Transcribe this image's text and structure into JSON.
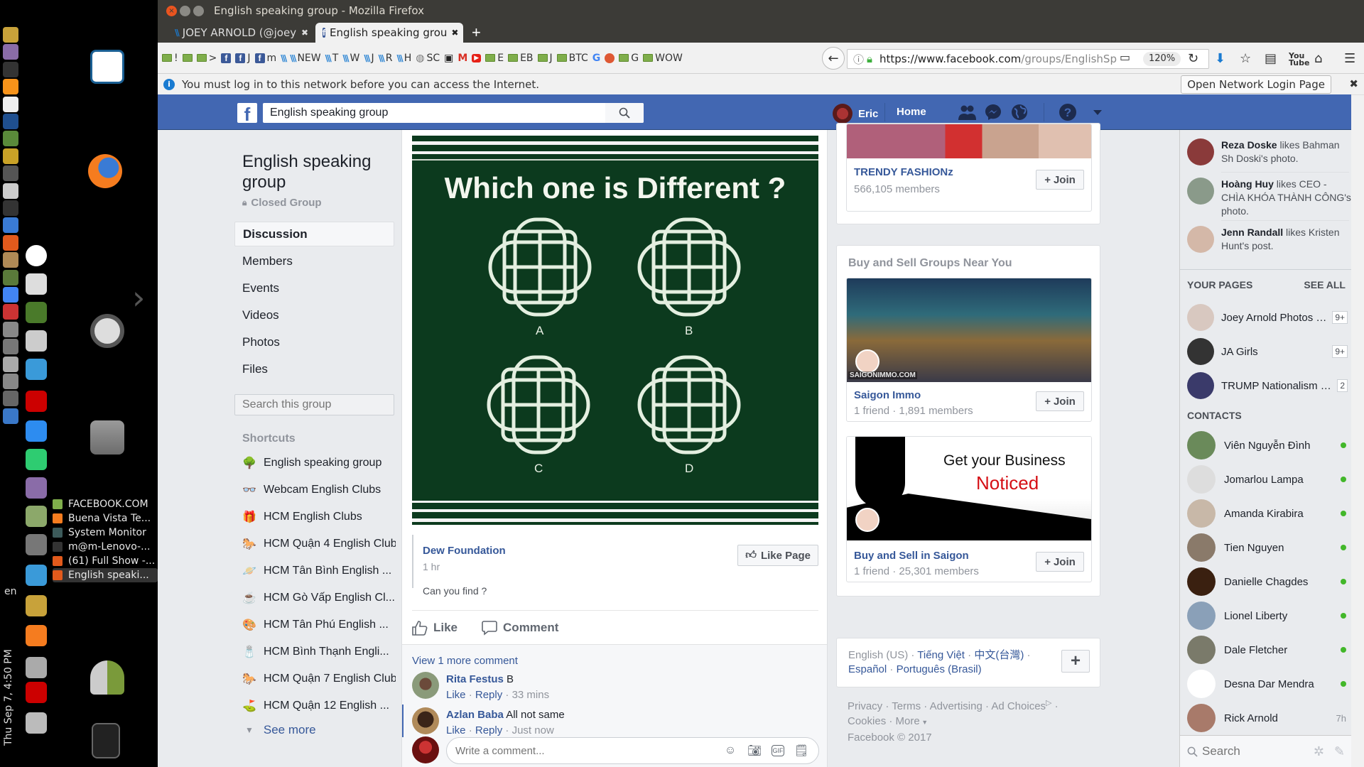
{
  "desktop": {
    "left_launcher_icons": [
      "dogecoin-icon",
      "face-icon",
      "inkscape-icon",
      "bitcoin-icon",
      "text-editor-icon",
      "calculator-icon",
      "terminal-icon",
      "workspace-icon",
      "window-switch-icon",
      "screenshot-icon",
      "system-monitor-icon",
      "media-player-icon",
      "audacity-icon",
      "archive-icon",
      "settings-icon",
      "chromium-icon",
      "joystick-icon",
      "lock-screen-icon",
      "disk-icon",
      "drive-icon",
      "drive-settings-icon",
      "update-icon",
      "back-icon"
    ],
    "second_column_icons": [
      "obs-icon",
      "volume-knob-icon",
      "network-card-icon",
      "webcam-icon",
      "electrum-icon",
      "filezilla-icon",
      "app-icon",
      "telegram-icon",
      "cheese-icon",
      "hanger-icon",
      "gpu-icon",
      "litecoin-icon",
      "dogecoin-icon",
      "vlc-icon",
      "bluetooth-icon",
      "filezilla-icon",
      "image-viewer-icon"
    ],
    "desktop_icons": [
      "libreoffice-writer-icon",
      "firefox-icon",
      "ubuntu-icon",
      "file-cabinet-icon",
      "user-switch-icon",
      "trash-icon"
    ],
    "window_list": [
      {
        "label": "FACEBOOK.COM",
        "icon": "folder-icon"
      },
      {
        "label": "Buena Vista Te...",
        "icon": "vlc-icon"
      },
      {
        "label": "System Monitor",
        "icon": "system-monitor-icon"
      },
      {
        "label": "m@m-Lenovo-...",
        "icon": "terminal-icon"
      },
      {
        "label": "(61) Full Show -...",
        "icon": "firefox-icon"
      },
      {
        "label": "English speaki...",
        "icon": "firefox-icon",
        "active": true
      }
    ],
    "indicator_lang": "en",
    "clock": "Thu Sep 7, 4:50 PM"
  },
  "browser": {
    "window_title": "English speaking group - Mozilla Firefox",
    "tabs": [
      {
        "label": "JOEY ARNOLD (@joey",
        "icon": "steemit-icon"
      },
      {
        "label": "English speaking grou",
        "icon": "facebook-icon",
        "active": true
      }
    ],
    "bookmarks": [
      {
        "label": "!",
        "icon": "folder"
      },
      {
        "label": "",
        "icon": "folder"
      },
      {
        "label": ">",
        "icon": "folder"
      },
      {
        "label": "",
        "icon": "fb"
      },
      {
        "label": "J",
        "icon": "fb"
      },
      {
        "label": "m",
        "icon": "fb"
      },
      {
        "label": "",
        "icon": "steem"
      },
      {
        "label": "NEW",
        "icon": "steem"
      },
      {
        "label": "T",
        "icon": "steem"
      },
      {
        "label": "W",
        "icon": "steem"
      },
      {
        "label": "J",
        "icon": "steem"
      },
      {
        "label": "R",
        "icon": "steem"
      },
      {
        "label": "H",
        "icon": "steem"
      },
      {
        "label": "SC",
        "icon": "globe"
      },
      {
        "label": "",
        "icon": "printer"
      },
      {
        "label": "",
        "icon": "gmail"
      },
      {
        "label": "",
        "icon": "youtube"
      },
      {
        "label": "E",
        "icon": "folder"
      },
      {
        "label": "EB",
        "icon": "folder"
      },
      {
        "label": "J",
        "icon": "folder"
      },
      {
        "label": "BTC",
        "icon": "folder"
      },
      {
        "label": "",
        "icon": "google"
      },
      {
        "label": "",
        "icon": "duckduckgo"
      },
      {
        "label": "G",
        "icon": "folder"
      },
      {
        "label": "WOW",
        "icon": "folder"
      }
    ],
    "url_domain": "https://www.facebook.com",
    "url_path": "/groups/EnglishSp",
    "zoom_level": "120%",
    "notification": "You must log in to this network before you can access the Internet.",
    "notification_button": "Open Network Login Page"
  },
  "fb": {
    "search_value": "English speaking group",
    "user_name": "Eric",
    "home_label": "Home",
    "colors": {
      "brand": "#4267b2",
      "link": "#365899",
      "online": "#42b72a"
    },
    "group": {
      "name": "English speaking group",
      "privacy": "Closed Group",
      "nav": [
        "Discussion",
        "Members",
        "Events",
        "Videos",
        "Photos",
        "Files"
      ],
      "active_nav": "Discussion",
      "search_placeholder": "Search this group",
      "shortcuts_title": "Shortcuts",
      "shortcuts": [
        {
          "label": "English speaking group",
          "icon": "🌳"
        },
        {
          "label": "Webcam English Clubs",
          "icon": "👓"
        },
        {
          "label": "HCM English Clubs",
          "icon": "🎁"
        },
        {
          "label": "HCM Quận 4 English Club",
          "icon": "🐎"
        },
        {
          "label": "HCM Tân Bình English ...",
          "icon": "🪐"
        },
        {
          "label": "HCM Gò Vấp English Cl...",
          "icon": "☕"
        },
        {
          "label": "HCM Tân Phú English ...",
          "icon": "🎨"
        },
        {
          "label": "HCM Bình Thạnh Engli...",
          "icon": "🧂"
        },
        {
          "label": "HCM Quận 7 English Club",
          "icon": "🐎"
        },
        {
          "label": "HCM Quận 12 English ...",
          "icon": "⛳"
        }
      ],
      "see_more": "See more"
    },
    "post": {
      "image_title": "Which one is Different ?",
      "image_options": [
        "A",
        "B",
        "C",
        "D"
      ],
      "page_name": "Dew Foundation",
      "time": "1 hr",
      "text": "Can you find ?",
      "like_page_label": "Like Page",
      "like_label": "Like",
      "comment_label": "Comment",
      "view_more": "View 1 more comment",
      "comments": [
        {
          "name": "Rita Festus",
          "text": "B",
          "like": "Like",
          "reply": "Reply",
          "time": "33 mins"
        },
        {
          "name": "Azlan Baba",
          "text": "All not same",
          "like": "Like",
          "reply": "Reply",
          "time": "Just now"
        }
      ],
      "write_placeholder": "Write a comment..."
    },
    "suggested": {
      "top_group": {
        "name": "TRENDY FASHIONz",
        "meta": "566,105 members",
        "join": "Join"
      },
      "buy_sell_title": "Buy and Sell Groups Near You",
      "buy_sell_groups": [
        {
          "name": "Saigon Immo",
          "meta": "1 friend · 1,891 members",
          "join": "Join",
          "image_caption": "SAIGONIMMO.COM"
        },
        {
          "name": "Buy and Sell in Saigon",
          "meta": "1 friend · 25,301 members",
          "join": "Join",
          "image_line1": "Get your Business",
          "image_line2": "Noticed"
        }
      ]
    },
    "languages": {
      "current": "English (US)",
      "others": [
        "Tiếng Việt",
        "中文(台灣)",
        "Español",
        "Português (Brasil)"
      ]
    },
    "footer": {
      "links": [
        "Privacy",
        "Terms",
        "Advertising",
        "Ad Choices",
        "Cookies",
        "More"
      ],
      "copyright": "Facebook © 2017"
    },
    "ticker": [
      {
        "actor": "Reza Doske",
        "text": " likes Bahman Sh Doski's photo."
      },
      {
        "actor": "Hoàng Huy",
        "text": " likes CEO - CHÌA KHÓA THÀNH CÔNG's photo."
      },
      {
        "actor": "Jenn Randall",
        "text": " likes Kristen Hunt's post."
      }
    ],
    "your_pages_title": "YOUR PAGES",
    "see_all": "SEE ALL",
    "pages": [
      {
        "name": "Joey Arnold Photos S...",
        "badge": "9+"
      },
      {
        "name": "JA Girls",
        "badge": "9+"
      },
      {
        "name": "TRUMP Nationalism O...",
        "badge": "2"
      }
    ],
    "contacts_title": "CONTACTS",
    "contacts": [
      {
        "name": "Viên Nguyễn Đình",
        "status": "online"
      },
      {
        "name": "Jomarlou Lampa",
        "status": "online"
      },
      {
        "name": "Amanda Kirabira",
        "status": "online"
      },
      {
        "name": "Tien Nguyen",
        "status": "online"
      },
      {
        "name": "Danielle Chagdes",
        "status": "online"
      },
      {
        "name": "Lionel Liberty",
        "status": "online"
      },
      {
        "name": "Dale Fletcher",
        "status": "online"
      },
      {
        "name": "Desna Dar Mendra",
        "status": "online"
      },
      {
        "name": "Rick Arnold",
        "status": "7h"
      }
    ],
    "chat_search_placeholder": "Search"
  }
}
